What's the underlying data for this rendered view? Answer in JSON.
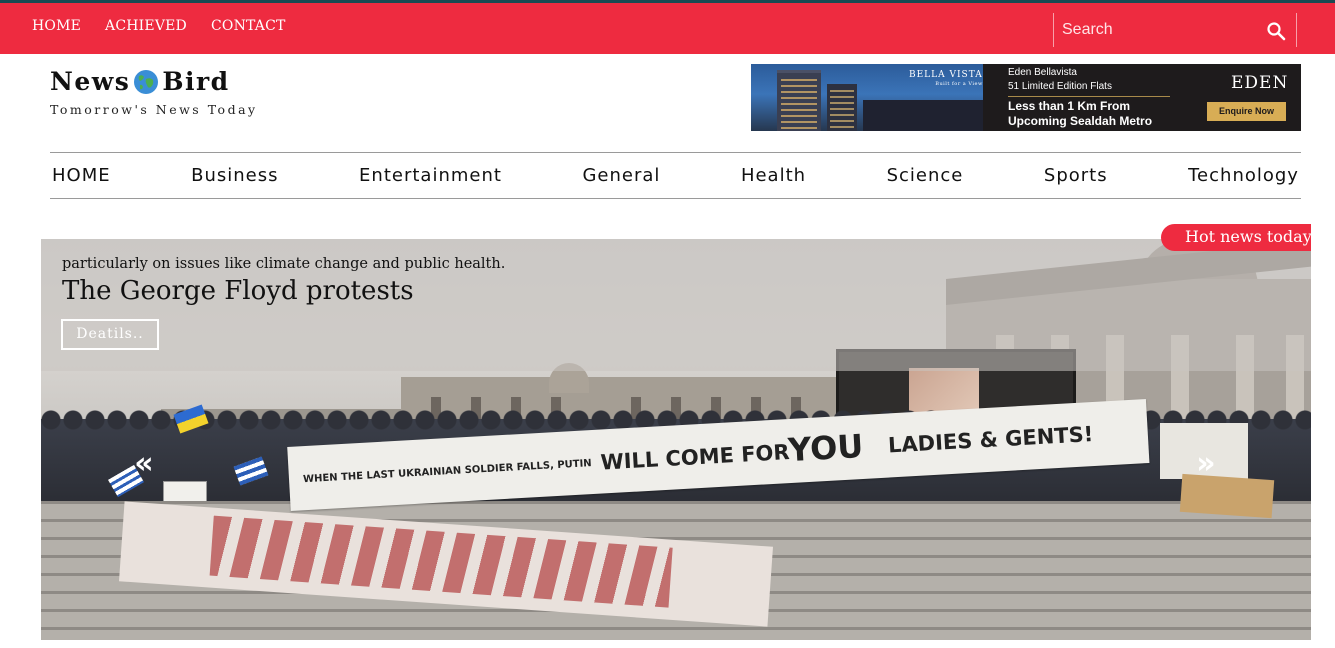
{
  "topbar": {
    "nav": [
      "HOME",
      "ACHIEVED",
      "CONTACT"
    ],
    "search_placeholder": "Search",
    "icons": {
      "search": "search-icon"
    },
    "colors": {
      "bar": "#ee2b40",
      "accent_line": "#1a4a52"
    }
  },
  "logo": {
    "name_part1": "News",
    "name_part2": "Bird",
    "icon": "globe-icon",
    "tagline": "Tomorrow's News Today"
  },
  "ad": {
    "brand_small": "BELLA VISTA",
    "brand_tag": "Built for a View",
    "line1": "Eden Bellavista",
    "line2": "51 Limited Edition Flats",
    "line3": "Less than 1 Km From",
    "line4": "Upcoming Sealdah Metro",
    "logo": "EDEN",
    "cta": "Enquire Now"
  },
  "mainnav": [
    "HOME",
    "Business",
    "Entertainment",
    "General",
    "Health",
    "Science",
    "Sports",
    "Technology"
  ],
  "hero": {
    "subline": "particularly on issues like climate change and public health.",
    "headline": "The George Floyd protests",
    "details_label": "Deatils..",
    "badge": "Hot news today",
    "prev_icon": "double-chevron-left-icon",
    "next_icon": "double-chevron-right-icon",
    "banner_text": {
      "part1": "WHEN THE LAST UKRAINIAN SOLDIER FALLS, PUTIN",
      "part2": "WILL COME FOR",
      "part3": "YOU",
      "part4": "LADIES & GENTS!"
    }
  }
}
